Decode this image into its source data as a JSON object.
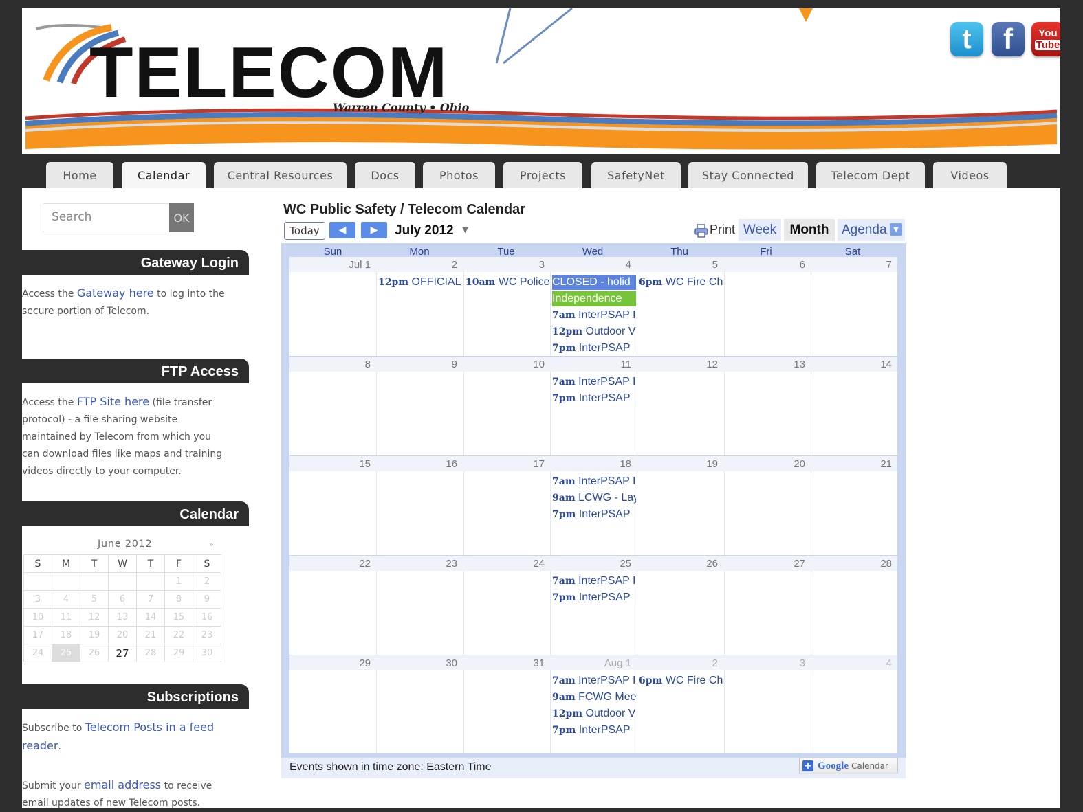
{
  "header": {
    "logo_word": "TELECOM",
    "logo_subtitle": "Warren County • Ohio",
    "social": [
      {
        "name": "twitter-icon",
        "glyph": "t"
      },
      {
        "name": "facebook-icon",
        "glyph": "f"
      },
      {
        "name": "youtube-icon",
        "line1": "You",
        "line2": "Tube"
      }
    ],
    "colors": {
      "swoosh_orange": "#f7941d",
      "swoosh_blue": "#4a7bbf",
      "swoosh_red": "#c0392b"
    }
  },
  "nav": {
    "tabs": [
      {
        "label": "Home",
        "active": false
      },
      {
        "label": "Calendar",
        "active": true
      },
      {
        "label": "Central Resources",
        "active": false
      },
      {
        "label": "Docs",
        "active": false
      },
      {
        "label": "Photos",
        "active": false
      },
      {
        "label": "Projects",
        "active": false
      },
      {
        "label": "SafetyNet",
        "active": false
      },
      {
        "label": "Stay Connected",
        "active": false
      },
      {
        "label": "Telecom Dept",
        "active": false
      },
      {
        "label": "Videos",
        "active": false
      }
    ]
  },
  "sidebar": {
    "search": {
      "placeholder": "Search",
      "button": "OK"
    },
    "gateway": {
      "title": "Gateway Login",
      "text_before": "Access the ",
      "link": "Gateway here",
      "text_after": " to log into the secure portion of Telecom."
    },
    "ftp": {
      "title": "FTP Access",
      "text_before": "Access the ",
      "link": "FTP Site here",
      "text_after": " (file transfer protocol) - a file sharing website maintained by Telecom from which you can download files like maps and training videos directly to your computer."
    },
    "calendar": {
      "title": "Calendar",
      "month": "June 2012",
      "next": "»",
      "weekdays": [
        "S",
        "M",
        "T",
        "W",
        "T",
        "F",
        "S"
      ],
      "weeks": [
        [
          "",
          "",
          "",
          "",
          "",
          "1",
          "2"
        ],
        [
          "3",
          "4",
          "5",
          "6",
          "7",
          "8",
          "9"
        ],
        [
          "10",
          "11",
          "12",
          "13",
          "14",
          "15",
          "16"
        ],
        [
          "17",
          "18",
          "19",
          "20",
          "21",
          "22",
          "23"
        ],
        [
          "24",
          "25",
          "26",
          "27",
          "28",
          "29",
          "30"
        ]
      ]
    },
    "subscriptions": {
      "title": "Subscriptions",
      "text1_before": "Subscribe to ",
      "text1_link": "Telecom Posts in a feed reader",
      "text1_after": ".",
      "text2_before": "Submit your ",
      "text2_link": "email address",
      "text2_after": " to receive email updates of new Telecom posts."
    }
  },
  "calendar": {
    "title": "WC Public Safety / Telecom Calendar",
    "today_label": "Today",
    "prev_icon": "◀",
    "next_icon": "▶",
    "month_label": "July 2012",
    "print_label": "Print",
    "views": [
      {
        "label": "Week",
        "active": false
      },
      {
        "label": "Month",
        "active": true
      },
      {
        "label": "Agenda",
        "active": false
      }
    ],
    "weekdays": [
      "Sun",
      "Mon",
      "Tue",
      "Wed",
      "Thu",
      "Fri",
      "Sat"
    ],
    "weeks": [
      {
        "days": [
          {
            "d": "Jul 1"
          },
          {
            "d": "2"
          },
          {
            "d": "3"
          },
          {
            "d": "4"
          },
          {
            "d": "5"
          },
          {
            "d": "6"
          },
          {
            "d": "7"
          }
        ]
      },
      {
        "days": [
          {
            "d": "8"
          },
          {
            "d": "9"
          },
          {
            "d": "10"
          },
          {
            "d": "11"
          },
          {
            "d": "12"
          },
          {
            "d": "13"
          },
          {
            "d": "14"
          }
        ]
      },
      {
        "days": [
          {
            "d": "15"
          },
          {
            "d": "16"
          },
          {
            "d": "17"
          },
          {
            "d": "18"
          },
          {
            "d": "19"
          },
          {
            "d": "20"
          },
          {
            "d": "21"
          }
        ]
      },
      {
        "days": [
          {
            "d": "22"
          },
          {
            "d": "23"
          },
          {
            "d": "24"
          },
          {
            "d": "25"
          },
          {
            "d": "26"
          },
          {
            "d": "27"
          },
          {
            "d": "28"
          }
        ]
      },
      {
        "days": [
          {
            "d": "29"
          },
          {
            "d": "30"
          },
          {
            "d": "31"
          },
          {
            "d": "Aug 1",
            "other": true
          },
          {
            "d": "2",
            "other": true
          },
          {
            "d": "3",
            "other": true
          },
          {
            "d": "4",
            "other": true
          }
        ]
      }
    ],
    "events": [
      {
        "week": 0,
        "day": 1,
        "slot": 0,
        "time": "12pm",
        "title": "OFFICIAL"
      },
      {
        "week": 0,
        "day": 2,
        "slot": 0,
        "time": "10am",
        "title": "WC Police"
      },
      {
        "week": 0,
        "day": 3,
        "slot": 0,
        "time": "",
        "title": "CLOSED - holid",
        "style": "closed"
      },
      {
        "week": 0,
        "day": 3,
        "slot": 1,
        "time": "",
        "title": "Independence",
        "style": "indep"
      },
      {
        "week": 0,
        "day": 3,
        "slot": 2,
        "time": "7am",
        "title": "InterPSAP I"
      },
      {
        "week": 0,
        "day": 3,
        "slot": 3,
        "time": "12pm",
        "title": "Outdoor V"
      },
      {
        "week": 0,
        "day": 3,
        "slot": 4,
        "time": "7pm",
        "title": "InterPSAP"
      },
      {
        "week": 0,
        "day": 4,
        "slot": 0,
        "time": "6pm",
        "title": "WC Fire Ch"
      },
      {
        "week": 1,
        "day": 3,
        "slot": 0,
        "time": "7am",
        "title": "InterPSAP I"
      },
      {
        "week": 1,
        "day": 3,
        "slot": 1,
        "time": "7pm",
        "title": "InterPSAP"
      },
      {
        "week": 2,
        "day": 3,
        "slot": 0,
        "time": "7am",
        "title": "InterPSAP I"
      },
      {
        "week": 2,
        "day": 3,
        "slot": 1,
        "time": "9am",
        "title": "LCWG - Lay"
      },
      {
        "week": 2,
        "day": 3,
        "slot": 2,
        "time": "7pm",
        "title": "InterPSAP"
      },
      {
        "week": 3,
        "day": 3,
        "slot": 0,
        "time": "7am",
        "title": "InterPSAP I"
      },
      {
        "week": 3,
        "day": 3,
        "slot": 1,
        "time": "7pm",
        "title": "InterPSAP"
      },
      {
        "week": 4,
        "day": 3,
        "slot": 0,
        "time": "7am",
        "title": "InterPSAP I"
      },
      {
        "week": 4,
        "day": 3,
        "slot": 1,
        "time": "9am",
        "title": "FCWG Mee"
      },
      {
        "week": 4,
        "day": 3,
        "slot": 2,
        "time": "12pm",
        "title": "Outdoor V"
      },
      {
        "week": 4,
        "day": 3,
        "slot": 3,
        "time": "7pm",
        "title": "InterPSAP"
      },
      {
        "week": 4,
        "day": 4,
        "slot": 0,
        "time": "6pm",
        "title": "WC Fire Ch"
      }
    ],
    "timezone": "Events shown in time zone: Eastern Time",
    "google_button": {
      "plus": "+",
      "brand": "Google",
      "label": "Calendar"
    }
  }
}
